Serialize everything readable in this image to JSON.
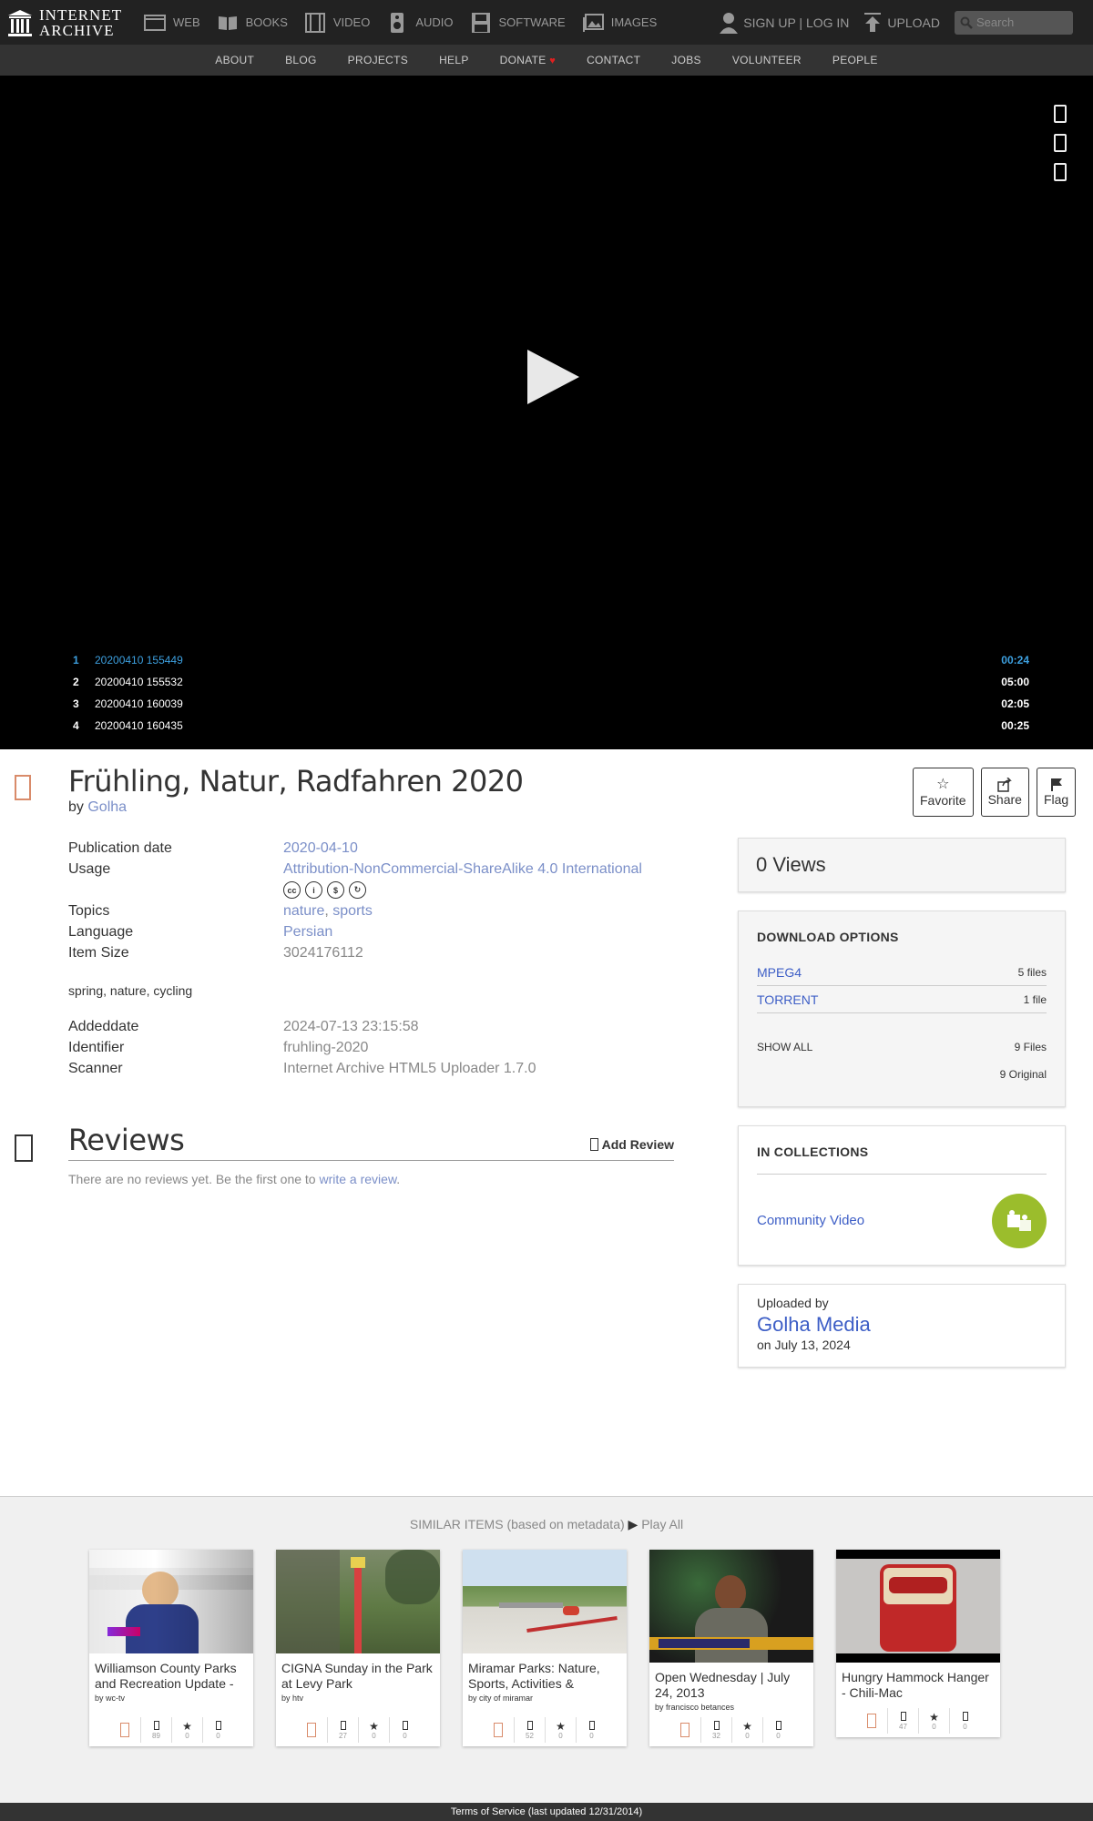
{
  "brand": {
    "line1": "INTERNET",
    "line2": "ARCHIVE"
  },
  "nav": {
    "items": [
      {
        "label": "WEB",
        "icon": "web-icon"
      },
      {
        "label": "BOOKS",
        "icon": "books-icon"
      },
      {
        "label": "VIDEO",
        "icon": "video-icon"
      },
      {
        "label": "AUDIO",
        "icon": "audio-icon"
      },
      {
        "label": "SOFTWARE",
        "icon": "software-icon"
      },
      {
        "label": "IMAGES",
        "icon": "images-icon"
      }
    ],
    "signup": "SIGN UP | LOG IN",
    "upload": "UPLOAD",
    "search_placeholder": "Search"
  },
  "subnav": [
    "ABOUT",
    "BLOG",
    "PROJECTS",
    "HELP",
    "DONATE",
    "CONTACT",
    "JOBS",
    "VOLUNTEER",
    "PEOPLE"
  ],
  "playlist": [
    {
      "num": "1",
      "title": "20200410 155449",
      "duration": "00:24",
      "active": true
    },
    {
      "num": "2",
      "title": "20200410 155532",
      "duration": "05:00",
      "active": false
    },
    {
      "num": "3",
      "title": "20200410 160039",
      "duration": "02:05",
      "active": false
    },
    {
      "num": "4",
      "title": "20200410 160435",
      "duration": "00:25",
      "active": false
    }
  ],
  "item": {
    "title": "Frühling, Natur, Radfahren 2020",
    "by_prefix": "by",
    "creator": "Golha"
  },
  "actions": {
    "favorite": "Favorite",
    "share": "Share",
    "flag": "Flag"
  },
  "meta": {
    "pubdate_label": "Publication date",
    "pubdate": "2020-04-10",
    "usage_label": "Usage",
    "usage": "Attribution-NonCommercial-ShareAlike 4.0 International",
    "topics_label": "Topics",
    "topic1": "nature",
    "topic_sep": ", ",
    "topic2": "sports",
    "language_label": "Language",
    "language": "Persian",
    "size_label": "Item Size",
    "size": "3024176112",
    "keywords": "spring, nature, cycling",
    "added_label": "Addeddate",
    "added": "2024-07-13 23:15:58",
    "identifier_label": "Identifier",
    "identifier": "fruhling-2020",
    "scanner_label": "Scanner",
    "scanner": "Internet Archive HTML5 Uploader 1.7.0"
  },
  "reviews": {
    "title": "Reviews",
    "add": "Add Review",
    "empty_text": "There are no reviews yet. Be the first one to",
    "write_link": "write a review",
    "period": "."
  },
  "views": "0 Views",
  "downloads": {
    "title": "DOWNLOAD OPTIONS",
    "rows": [
      {
        "label": "MPEG4",
        "count": "5 files"
      },
      {
        "label": "TORRENT",
        "count": "1 file"
      }
    ],
    "show_all": "SHOW ALL",
    "total": "9 Files",
    "original": "9 Original"
  },
  "collections": {
    "title": "IN COLLECTIONS",
    "name": "Community Video"
  },
  "uploader": {
    "label": "Uploaded by",
    "name": "Golha Media",
    "date": "on July 13, 2024"
  },
  "similar": {
    "heading": "SIMILAR ITEMS (based on metadata)",
    "play_all": "Play All",
    "cards": [
      {
        "title": "Williamson County Parks and Recreation Update -",
        "by": "by wc-tv",
        "views": "89",
        "favs": "0",
        "reviews": "0"
      },
      {
        "title": "CIGNA Sunday in the Park at Levy Park",
        "by": "by htv",
        "views": "27",
        "favs": "0",
        "reviews": "0"
      },
      {
        "title": "Miramar Parks: Nature, Sports, Activities &",
        "by": "by city of miramar",
        "views": "52",
        "favs": "0",
        "reviews": "0"
      },
      {
        "title": "Open Wednesday | July 24, 2013",
        "by": "by francisco betances",
        "views": "32",
        "favs": "0",
        "reviews": "0"
      },
      {
        "title": "Hungry Hammock Hanger - Chili-Mac",
        "by": "",
        "views": "47",
        "favs": "0",
        "reviews": "0"
      }
    ]
  },
  "footer": "Terms of Service (last updated 12/31/2014)"
}
